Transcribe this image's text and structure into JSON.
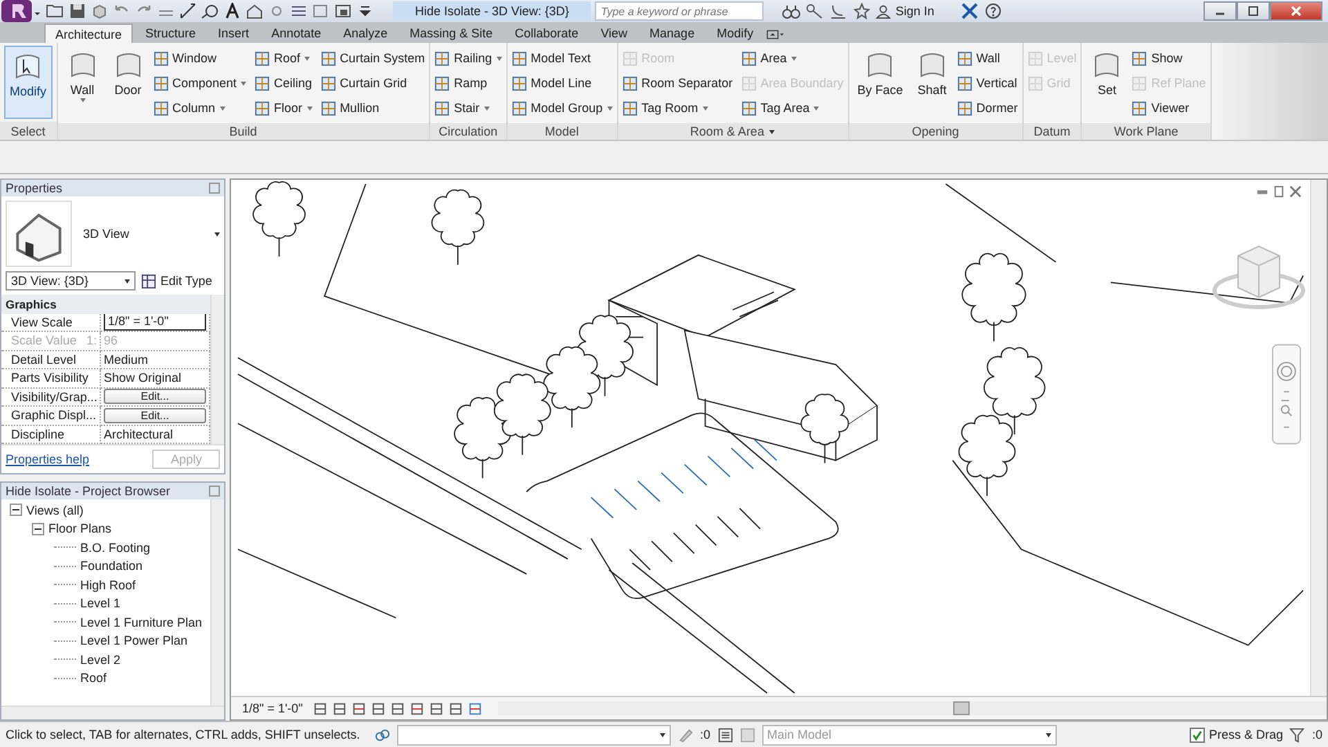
{
  "title_bar": {
    "title": "Hide Isolate - 3D View: {3D}",
    "search": {
      "placeholder": "Type a keyword or phrase"
    },
    "sign_in": "Sign In"
  },
  "tabs": [
    {
      "label": "Architecture",
      "selected": true
    },
    {
      "label": "Structure",
      "selected": false
    },
    {
      "label": "Insert",
      "selected": false
    },
    {
      "label": "Annotate",
      "selected": false
    },
    {
      "label": "Analyze",
      "selected": false
    },
    {
      "label": "Massing & Site",
      "selected": false
    },
    {
      "label": "Collaborate",
      "selected": false
    },
    {
      "label": "View",
      "selected": false
    },
    {
      "label": "Manage",
      "selected": false
    },
    {
      "label": "Modify",
      "selected": false
    }
  ],
  "ribbon": [
    {
      "label": "Select",
      "menu": false,
      "items": [
        {
          "label": "Modify",
          "kind": "large",
          "dropdown": false,
          "disabled": false,
          "selected": true
        }
      ]
    },
    {
      "label": "Build",
      "menu": false,
      "items": [
        {
          "label": "Wall",
          "kind": "large",
          "dropdown": true,
          "disabled": false,
          "selected": false
        },
        {
          "label": "Door",
          "kind": "large",
          "dropdown": false,
          "disabled": false,
          "selected": false
        },
        {
          "label": "Window",
          "kind": "small",
          "dropdown": false,
          "disabled": false,
          "selected": false
        },
        {
          "label": "Component",
          "kind": "small",
          "dropdown": true,
          "disabled": false,
          "selected": false
        },
        {
          "label": "Column",
          "kind": "small",
          "dropdown": true,
          "disabled": false,
          "selected": false
        },
        {
          "label": "Roof",
          "kind": "small",
          "dropdown": true,
          "disabled": false,
          "selected": false
        },
        {
          "label": "Ceiling",
          "kind": "small",
          "dropdown": false,
          "disabled": false,
          "selected": false
        },
        {
          "label": "Floor",
          "kind": "small",
          "dropdown": true,
          "disabled": false,
          "selected": false
        },
        {
          "label": "Curtain System",
          "kind": "small",
          "dropdown": false,
          "disabled": false,
          "selected": false
        },
        {
          "label": "Curtain Grid",
          "kind": "small",
          "dropdown": false,
          "disabled": false,
          "selected": false
        },
        {
          "label": "Mullion",
          "kind": "small",
          "dropdown": false,
          "disabled": false,
          "selected": false
        }
      ]
    },
    {
      "label": "Circulation",
      "menu": false,
      "items": [
        {
          "label": "Railing",
          "kind": "small",
          "dropdown": true,
          "disabled": false,
          "selected": false
        },
        {
          "label": "Ramp",
          "kind": "small",
          "dropdown": false,
          "disabled": false,
          "selected": false
        },
        {
          "label": "Stair",
          "kind": "small",
          "dropdown": true,
          "disabled": false,
          "selected": false
        }
      ]
    },
    {
      "label": "Model",
      "menu": false,
      "items": [
        {
          "label": "Model Text",
          "kind": "small",
          "dropdown": false,
          "disabled": false,
          "selected": false
        },
        {
          "label": "Model Line",
          "kind": "small",
          "dropdown": false,
          "disabled": false,
          "selected": false
        },
        {
          "label": "Model Group",
          "kind": "small",
          "dropdown": true,
          "disabled": false,
          "selected": false
        }
      ]
    },
    {
      "label": "Room & Area",
      "menu": true,
      "items": [
        {
          "label": "Room",
          "kind": "small",
          "dropdown": false,
          "disabled": true,
          "selected": false
        },
        {
          "label": "Room Separator",
          "kind": "small",
          "dropdown": false,
          "disabled": false,
          "selected": false
        },
        {
          "label": "Tag Room",
          "kind": "small",
          "dropdown": true,
          "disabled": false,
          "selected": false
        },
        {
          "label": "Area",
          "kind": "small",
          "dropdown": true,
          "disabled": false,
          "selected": false
        },
        {
          "label": "Area Boundary",
          "kind": "small",
          "dropdown": false,
          "disabled": true,
          "selected": false
        },
        {
          "label": "Tag Area",
          "kind": "small",
          "dropdown": true,
          "disabled": false,
          "selected": false
        }
      ]
    },
    {
      "label": "Opening",
      "menu": false,
      "items": [
        {
          "label": "By Face",
          "kind": "large",
          "dropdown": false,
          "disabled": false,
          "selected": false
        },
        {
          "label": "Shaft",
          "kind": "large",
          "dropdown": false,
          "disabled": false,
          "selected": false
        },
        {
          "label": "Wall",
          "kind": "small",
          "dropdown": false,
          "disabled": false,
          "selected": false
        },
        {
          "label": "Vertical",
          "kind": "small",
          "dropdown": false,
          "disabled": false,
          "selected": false
        },
        {
          "label": "Dormer",
          "kind": "small",
          "dropdown": false,
          "disabled": false,
          "selected": false
        }
      ]
    },
    {
      "label": "Datum",
      "menu": false,
      "items": [
        {
          "label": "Level",
          "kind": "small",
          "dropdown": false,
          "disabled": true,
          "selected": false
        },
        {
          "label": "Grid",
          "kind": "small",
          "dropdown": false,
          "disabled": true,
          "selected": false
        }
      ]
    },
    {
      "label": "Work Plane",
      "menu": false,
      "items": [
        {
          "label": "Set",
          "kind": "large",
          "dropdown": false,
          "disabled": false,
          "selected": false
        },
        {
          "label": "Show",
          "kind": "small",
          "dropdown": false,
          "disabled": false,
          "selected": false
        },
        {
          "label": "Ref Plane",
          "kind": "small",
          "dropdown": false,
          "disabled": true,
          "selected": false
        },
        {
          "label": "Viewer",
          "kind": "small",
          "dropdown": false,
          "disabled": false,
          "selected": false
        }
      ]
    }
  ],
  "properties": {
    "title": "Properties",
    "type_name": "3D View",
    "selector": "3D View: {3D}",
    "edit_type": "Edit Type",
    "group": "Graphics",
    "rows": [
      {
        "name": "View Scale",
        "value": "1/8\" = 1'-0\"",
        "kind": "input",
        "disabled": false
      },
      {
        "name": "Scale Value",
        "prefix": "1:",
        "value": "96",
        "kind": "text",
        "disabled": true
      },
      {
        "name": "Detail Level",
        "value": "Medium",
        "kind": "text",
        "disabled": false
      },
      {
        "name": "Parts Visibility",
        "value": "Show Original",
        "kind": "text",
        "disabled": false
      },
      {
        "name": "Visibility/Grap...",
        "value": "Edit...",
        "kind": "button",
        "disabled": false
      },
      {
        "name": "Graphic Displ...",
        "value": "Edit...",
        "kind": "button",
        "disabled": false
      },
      {
        "name": "Discipline",
        "value": "Architectural",
        "kind": "text",
        "disabled": false
      }
    ],
    "help": "Properties help",
    "apply": {
      "label": "Apply",
      "disabled": true
    }
  },
  "browser": {
    "title": "Hide Isolate - Project Browser",
    "tree": [
      {
        "label": "Views (all)",
        "expanded": true,
        "children": [
          {
            "label": "Floor Plans",
            "expanded": true,
            "children": [
              {
                "label": "B.O. Footing"
              },
              {
                "label": "Foundation"
              },
              {
                "label": "High Roof"
              },
              {
                "label": "Level 1"
              },
              {
                "label": "Level 1 Furniture Plan"
              },
              {
                "label": "Level 1 Power Plan"
              },
              {
                "label": "Level 2"
              },
              {
                "label": "Roof"
              }
            ]
          }
        ]
      }
    ]
  },
  "view_bar": {
    "scale": "1/8\" = 1'-0\""
  },
  "status_bar": {
    "message": "Click to select, TAB for alternates, CTRL adds, SHIFT unselects.",
    "editing_count": ":0",
    "model": "Main Model",
    "press_drag": {
      "label": "Press & Drag",
      "checked": true
    },
    "filter_count": ":0"
  }
}
